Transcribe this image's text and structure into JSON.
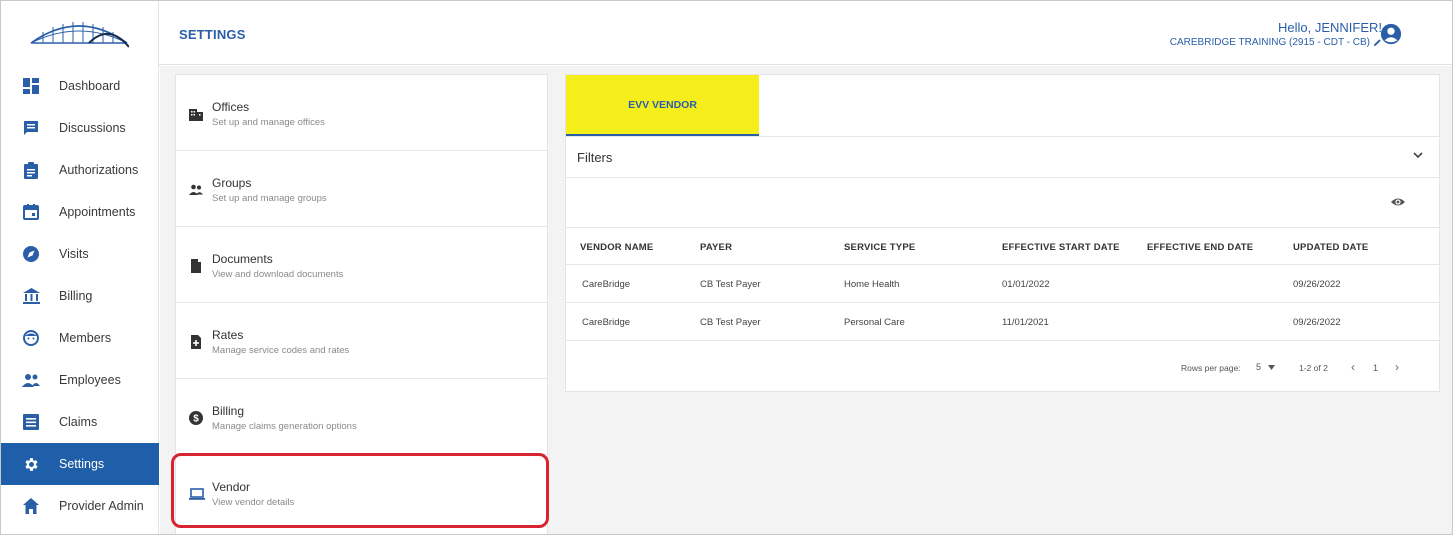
{
  "header": {
    "title": "SETTINGS",
    "greeting": "Hello, JENNIFER!",
    "account": "CAREBRIDGE TRAINING (2915 - CDT - CB)"
  },
  "sidebar": {
    "items": [
      {
        "label": "Dashboard",
        "icon": "dashboard-icon"
      },
      {
        "label": "Discussions",
        "icon": "chat-icon"
      },
      {
        "label": "Authorizations",
        "icon": "clipboard-icon"
      },
      {
        "label": "Appointments",
        "icon": "calendar-icon"
      },
      {
        "label": "Visits",
        "icon": "compass-icon"
      },
      {
        "label": "Billing",
        "icon": "bank-icon"
      },
      {
        "label": "Members",
        "icon": "face-icon"
      },
      {
        "label": "Employees",
        "icon": "people-icon"
      },
      {
        "label": "Claims",
        "icon": "list-icon"
      },
      {
        "label": "Settings",
        "icon": "gear-icon"
      },
      {
        "label": "Provider Admin",
        "icon": "home-icon"
      }
    ],
    "active_index": 9
  },
  "settings": {
    "items": [
      {
        "title": "Offices",
        "subtitle": "Set up and manage offices",
        "icon": "building-icon"
      },
      {
        "title": "Groups",
        "subtitle": "Set up and manage groups",
        "icon": "group-icon"
      },
      {
        "title": "Documents",
        "subtitle": "View and download documents",
        "icon": "document-icon"
      },
      {
        "title": "Rates",
        "subtitle": "Manage service codes and rates",
        "icon": "rates-icon"
      },
      {
        "title": "Billing",
        "subtitle": "Manage claims generation options",
        "icon": "dollar-icon"
      },
      {
        "title": "Vendor",
        "subtitle": "View vendor details",
        "icon": "laptop-icon"
      }
    ]
  },
  "vendor_panel": {
    "tab_label": "EVV VENDOR",
    "filters_label": "Filters",
    "columns": [
      "VENDOR NAME",
      "PAYER",
      "SERVICE TYPE",
      "EFFECTIVE START DATE",
      "EFFECTIVE END DATE",
      "UPDATED DATE"
    ],
    "rows": [
      [
        "CareBridge",
        "CB Test Payer",
        "Home Health",
        "01/01/2022",
        "",
        "09/26/2022"
      ],
      [
        "CareBridge",
        "CB Test Payer",
        "Personal Care",
        "11/01/2021",
        "",
        "09/26/2022"
      ]
    ],
    "pagination": {
      "rows_per_page_label": "Rows per page:",
      "rows_per_page_value": "5",
      "range": "1-2 of 2",
      "page": "1"
    }
  },
  "colors": {
    "brand_blue": "#1f5ea8",
    "tab_highlight": "#f6ee1a",
    "callout_red": "#d9242f"
  }
}
